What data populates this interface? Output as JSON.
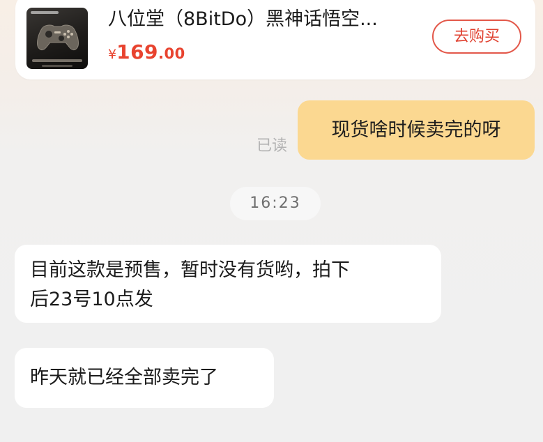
{
  "product": {
    "title": "八位堂（8BitDo）黑神话悟空...",
    "price": {
      "currency": "¥",
      "integer": "169",
      "decimal": ".00"
    },
    "buy_label": "去购买",
    "thumbnail_icon": "game-controller-icon"
  },
  "messages": {
    "outgoing": {
      "text": "现货啥时候卖完的呀",
      "status": "已读"
    },
    "timestamp": "16:23",
    "incoming": [
      {
        "lines": [
          "目前这款是预售，暂时没有货哟，拍下",
          "后23号10点发"
        ]
      },
      {
        "text": "昨天就已经全部卖完了"
      }
    ]
  },
  "colors": {
    "price": "#e8432f",
    "buy_button_border": "#e3584a",
    "outgoing_bubble": "#fbd891",
    "incoming_bubble": "#ffffff",
    "background": "#f0f0f0",
    "read_status": "#b2b2b2"
  }
}
